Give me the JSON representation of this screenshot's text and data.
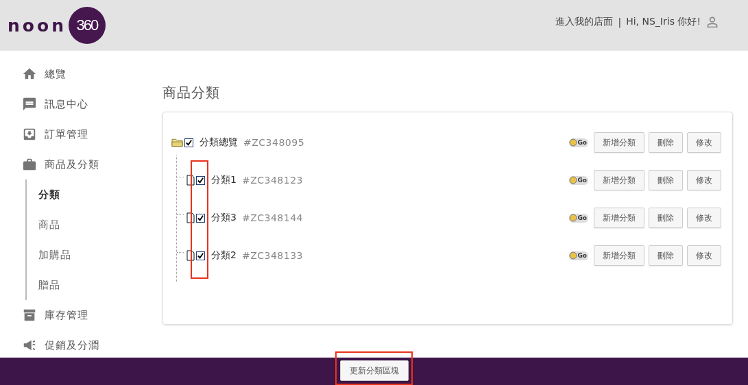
{
  "header": {
    "logo_text": "noon",
    "logo_badge": "360",
    "store_link": "進入我的店面",
    "separator": "|",
    "greeting": "Hi, NS_Iris 你好!"
  },
  "sidebar": {
    "items": [
      {
        "label": "總覽"
      },
      {
        "label": "訊息中心"
      },
      {
        "label": "訂單管理"
      },
      {
        "label": "商品及分類",
        "children": [
          {
            "label": "分類",
            "selected": true
          },
          {
            "label": "商品",
            "selected": false
          },
          {
            "label": "加購品",
            "selected": false
          },
          {
            "label": "贈品",
            "selected": false
          }
        ]
      },
      {
        "label": "庫存管理"
      },
      {
        "label": "促銷及分潤"
      }
    ]
  },
  "page_title": "商品分類",
  "tree": {
    "label": "分類總覽",
    "code": "#ZC348095",
    "checked": true,
    "go": "Go",
    "actions": [
      "新增分類",
      "刪除",
      "修改"
    ],
    "children": [
      {
        "label": "分類1",
        "code": "#ZC348123",
        "checked": true,
        "go": "Go",
        "actions": [
          "新增分類",
          "刪除",
          "修改"
        ]
      },
      {
        "label": "分類3",
        "code": "#ZC348144",
        "checked": true,
        "go": "Go",
        "actions": [
          "新增分類",
          "刪除",
          "修改"
        ]
      },
      {
        "label": "分類2",
        "code": "#ZC348133",
        "checked": true,
        "go": "Go",
        "actions": [
          "新增分類",
          "刪除",
          "修改"
        ]
      }
    ]
  },
  "footer": {
    "button": "更新分類區塊"
  }
}
